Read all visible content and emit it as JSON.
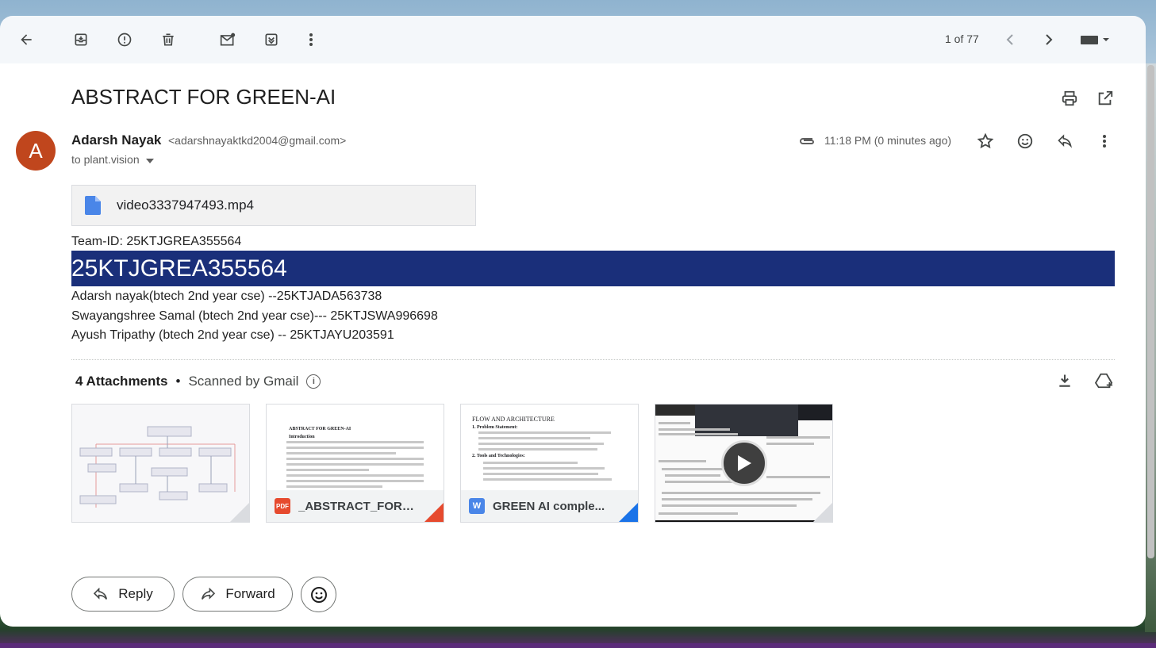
{
  "toolbar": {
    "pager": "1 of 77",
    "icons": [
      "back-arrow-icon",
      "archive-icon",
      "report-spam-icon",
      "delete-icon",
      "mark-unread-icon",
      "move-to-icon",
      "more-vert-icon",
      "chevron-left-icon",
      "chevron-right-icon",
      "keyboard-icon"
    ]
  },
  "email": {
    "subject": "ABSTRACT FOR GREEN-AI",
    "sender_initial": "A",
    "sender_name": "Adarsh Nayak",
    "sender_email": "<adarshnayaktkd2004@gmail.com>",
    "recipient": "to plant.vision",
    "timestamp": "11:18 PM (0 minutes ago)",
    "video_attachment": "video3337947493.mp4",
    "body": {
      "team_id_line": "Team-ID: 25KTJGREA355564",
      "highlight": "25KTJGREA355564",
      "members": [
        "Adarsh nayak(btech 2nd year cse) --25KTJADA563738",
        "Swayangshree Samal (btech 2nd year cse)--- 25KTJSWA996698",
        "Ayush Tripathy (btech 2nd year cse) -- 25KTJAYU203591"
      ]
    }
  },
  "attachments": {
    "count_label": "4 Attachments",
    "separator": "•",
    "scanned_label": "Scanned by Gmail",
    "items": [
      {
        "type": "image",
        "name": ""
      },
      {
        "type": "pdf",
        "type_label": "PDF",
        "name": "_ABSTRACT_FOR_...",
        "preview_title": "ABSTRACT FOR GREEN-AI",
        "preview_heading": "Introduction"
      },
      {
        "type": "word",
        "type_label": "W",
        "name": "GREEN AI comple...",
        "preview_title": "FLOW AND ARCHITECTURE",
        "preview_s1": "1. Problem Statement:",
        "preview_s2": "2. Tools and Technologies:"
      },
      {
        "type": "video",
        "name": ""
      }
    ]
  },
  "actions": {
    "reply": "Reply",
    "forward": "Forward"
  },
  "colors": {
    "highlight_bg": "#1a2f7a",
    "avatar_bg": "#c0461d",
    "pdf_red": "#e64a2e",
    "word_blue": "#4a86e8"
  }
}
